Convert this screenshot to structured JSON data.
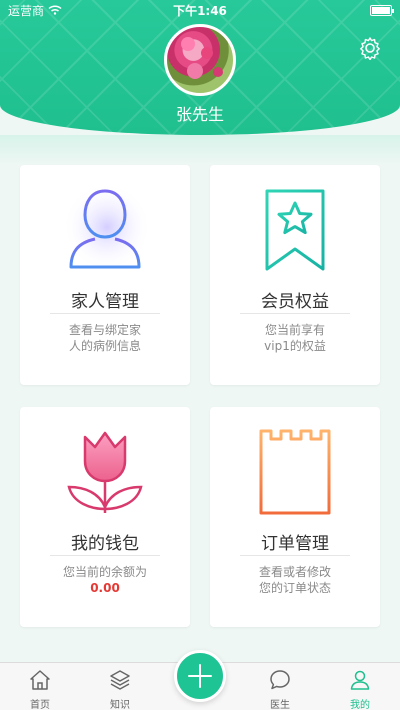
{
  "status_bar": {
    "carrier": "运营商",
    "time": "下午1:46"
  },
  "profile": {
    "username": "张先生"
  },
  "cards": [
    {
      "title": "家人管理",
      "desc_line1": "查看与绑定家",
      "desc_line2": "人的病例信息",
      "icon": "person-icon"
    },
    {
      "title": "会员权益",
      "desc_line1": "您当前享有",
      "desc_line2": "vip1的权益",
      "icon": "vip-ribbon-icon"
    },
    {
      "title": "我的钱包",
      "desc_line1": "您当前的余额为",
      "balance": "0.00",
      "icon": "tulip-icon"
    },
    {
      "title": "订单管理",
      "desc_line1": "查看或者修改",
      "desc_line2": "您的订单状态",
      "icon": "order-list-icon"
    }
  ],
  "tabs": [
    {
      "label": "首页",
      "icon": "home-icon"
    },
    {
      "label": "知识",
      "icon": "layers-icon"
    },
    {
      "label": "医生",
      "icon": "chat-bubble-icon"
    },
    {
      "label": "我的",
      "icon": "user-icon",
      "active": true
    }
  ],
  "colors": {
    "brand": "#1fbf8e",
    "balance": "#e53935"
  }
}
